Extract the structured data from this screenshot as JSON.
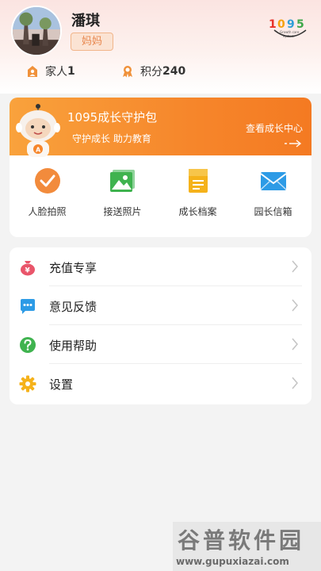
{
  "profile": {
    "name": "潘琪",
    "role": "妈妈",
    "logo_text": "1095",
    "logo_sub": "Growth care system"
  },
  "stats": {
    "family_label": "家人",
    "family_count": "1",
    "points_label": "积分",
    "points_value": "240"
  },
  "guard": {
    "title": "1095成长守护包",
    "subtitle": "守护成长 助力教育",
    "link": "查看成长中心",
    "mascot_badge": "A"
  },
  "quick_actions": [
    {
      "label": "人脸拍照",
      "icon": "face-check-icon"
    },
    {
      "label": "接送照片",
      "icon": "photo-icon"
    },
    {
      "label": "成长档案",
      "icon": "archive-icon"
    },
    {
      "label": "园长信箱",
      "icon": "mail-icon"
    }
  ],
  "menu": [
    {
      "label": "充值专享",
      "icon": "money-bag-icon"
    },
    {
      "label": "意见反馈",
      "icon": "feedback-icon"
    },
    {
      "label": "使用帮助",
      "icon": "help-icon"
    },
    {
      "label": "设置",
      "icon": "settings-gear-icon"
    }
  ],
  "watermark": {
    "title": "谷普软件园",
    "url": "www.gupuxiazai.com"
  },
  "colors": {
    "accent": "#f6862b",
    "badge_text": "#e8874e",
    "green": "#3fb34f",
    "blue": "#2d9be6",
    "yellow": "#f5b21b",
    "red": "#e9556a"
  }
}
